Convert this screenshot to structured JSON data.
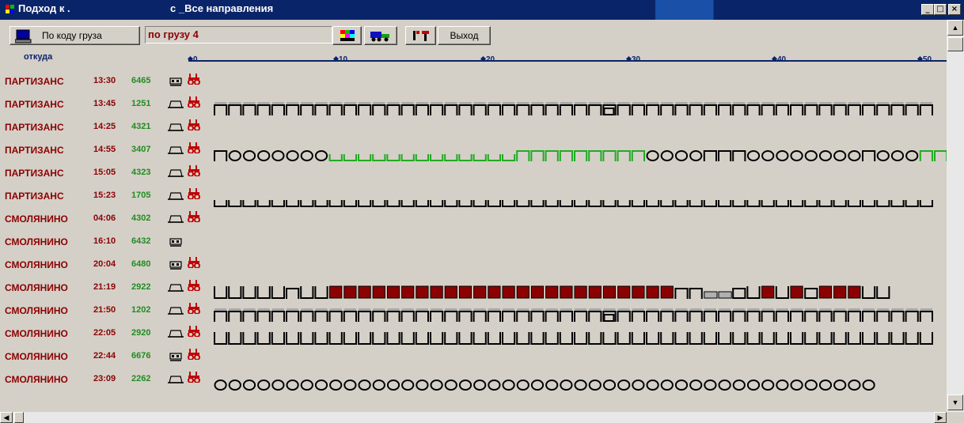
{
  "window": {
    "title_left": "Подход к .",
    "title_mid": "с _Все направления",
    "minimize": "_",
    "maximize": "□",
    "close": "×"
  },
  "toolbar": {
    "sort_button": "По коду груза",
    "filter_value": "по грузу 4",
    "exit_button": "Выход"
  },
  "columns": {
    "from": "откуда"
  },
  "axis_ticks": [
    "0",
    "10",
    "20",
    "30",
    "40",
    "50"
  ],
  "colors": {
    "station": "#8b0000",
    "number": "#228b22",
    "axis": "#0a246a",
    "wagon_dark": "#000000",
    "wagon_green": "#22aa22",
    "wagon_red": "#8b0000"
  },
  "rows": [
    {
      "station": "ПАРТИЗАНС",
      "time": "13:30",
      "number": "6465",
      "icon": "engine-icon",
      "loco": true,
      "pattern": ""
    },
    {
      "station": "ПАРТИЗАНС",
      "time": "13:45",
      "number": "1251",
      "icon": "car-icon",
      "loco": true,
      "pattern": "П"
    },
    {
      "station": "ПАРТИЗАНС",
      "time": "14:25",
      "number": "4321",
      "icon": "car-icon",
      "loco": true,
      "pattern": ""
    },
    {
      "station": "ПАРТИЗАНС",
      "time": "14:55",
      "number": "3407",
      "icon": "car-icon",
      "loco": true,
      "pattern": "mixed"
    },
    {
      "station": "ПАРТИЗАНС",
      "time": "15:05",
      "number": "4323",
      "icon": "car-icon",
      "loco": true,
      "pattern": ""
    },
    {
      "station": "ПАРТИЗАНС",
      "time": "15:23",
      "number": "1705",
      "icon": "car-icon",
      "loco": true,
      "pattern": "U"
    },
    {
      "station": "СМОЛЯНИНО",
      "time": "04:06",
      "number": "4302",
      "icon": "car-icon",
      "loco": true,
      "pattern": ""
    },
    {
      "station": "СМОЛЯНИНО",
      "time": "16:10",
      "number": "6432",
      "icon": "engine-icon",
      "loco": false,
      "pattern": ""
    },
    {
      "station": "СМОЛЯНИНО",
      "time": "20:04",
      "number": "6480",
      "icon": "engine-icon",
      "loco": true,
      "pattern": ""
    },
    {
      "station": "СМОЛЯНИНО",
      "time": "21:19",
      "number": "2922",
      "icon": "car-icon",
      "loco": true,
      "pattern": "redmix"
    },
    {
      "station": "СМОЛЯНИНО",
      "time": "21:50",
      "number": "1202",
      "icon": "car-icon",
      "loco": true,
      "pattern": "П"
    },
    {
      "station": "СМОЛЯНИНО",
      "time": "22:05",
      "number": "2920",
      "icon": "car-icon",
      "loco": true,
      "pattern": "Utall"
    },
    {
      "station": "СМОЛЯНИНО",
      "time": "22:44",
      "number": "6676",
      "icon": "engine-icon",
      "loco": true,
      "pattern": ""
    },
    {
      "station": "СМОЛЯНИНО",
      "time": "23:09",
      "number": "2262",
      "icon": "car-icon",
      "loco": true,
      "pattern": "O"
    }
  ]
}
